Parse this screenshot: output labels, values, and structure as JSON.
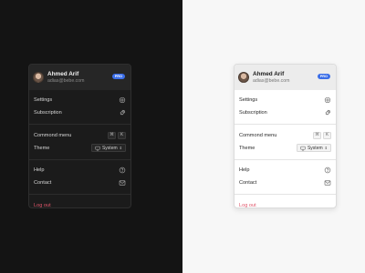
{
  "profile": {
    "name": "Ahmed Arif",
    "email": "adias@bebe.com",
    "badge": "PRO"
  },
  "items": {
    "settings": "Settings",
    "subscription": "Subscription",
    "command_menu": "Commond menu",
    "command_key_1": "⌘",
    "command_key_2": "K",
    "theme": "Theme",
    "theme_value": "System",
    "help": "Help",
    "contact": "Contact",
    "logout": "Log out"
  },
  "colors": {
    "dark_bg": "#141414",
    "light_bg": "#f7f7f7",
    "badge": "#3b6ee8",
    "logout": "#e0566a"
  },
  "icons": [
    "gear-icon",
    "rocket-icon",
    "monitor-icon",
    "help-circle-icon",
    "mail-icon"
  ]
}
